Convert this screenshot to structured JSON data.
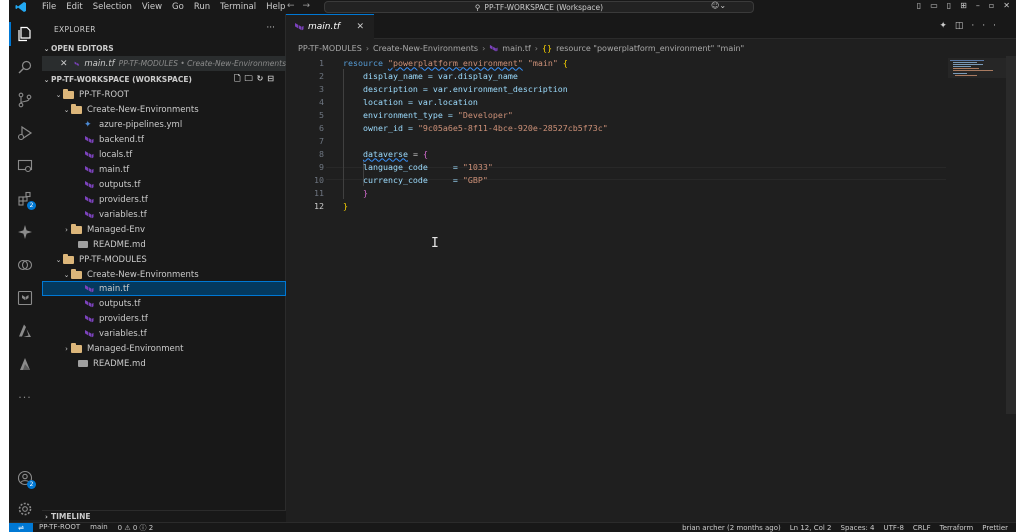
{
  "titlebar": {
    "menu": [
      "File",
      "Edit",
      "Selection",
      "View",
      "Go",
      "Run",
      "Terminal",
      "Help"
    ],
    "command_center": "PP-TF-WORKSPACE (Workspace)"
  },
  "activity": {
    "extensions_badge": "2",
    "accounts_badge": "2"
  },
  "sidebar": {
    "title": "EXPLORER",
    "open_editors": {
      "label": "OPEN EDITORS",
      "file": "main.tf",
      "path": "PP-TF-MODULES • Create-New-Environments"
    },
    "workspace_label": "PP-TF-WORKSPACE (WORKSPACE)",
    "root": {
      "name": "PP-TF-ROOT",
      "folder": "Create-New-Environments",
      "files": [
        "azure-pipelines.yml",
        "backend.tf",
        "locals.tf",
        "main.tf",
        "outputs.tf",
        "providers.tf",
        "variables.tf"
      ],
      "collapsed_folder": "Managed-Env",
      "readme": "README.md"
    },
    "modules": {
      "name": "PP-TF-MODULES",
      "folder": "Create-New-Environments",
      "files": [
        "main.tf",
        "outputs.tf",
        "providers.tf",
        "variables.tf"
      ],
      "collapsed_folder": "Managed-Environment",
      "readme": "README.md"
    },
    "timeline": "TIMELINE"
  },
  "editor": {
    "tab_name": "main.tf",
    "breadcrumb": [
      "PP-TF-MODULES",
      "Create-New-Environments",
      "main.tf",
      "resource \"powerplatform_environment\" \"main\""
    ],
    "line_numbers": [
      "1",
      "2",
      "3",
      "4",
      "5",
      "6",
      "7",
      "8",
      "9",
      "10",
      "11",
      "12"
    ],
    "code": {
      "l1_kw": "resource",
      "l1_type": "\"powerplatform_environment\"",
      "l1_name": "\"main\"",
      "l2": "display_name = var.display_name",
      "l3": "description = var.environment_description",
      "l4": "location = var.location",
      "l5_key": "environment_type = ",
      "l5_val": "\"Developer\"",
      "l6_key": "owner_id = ",
      "l6_val": "\"9c05a6e5-8f11-4bce-920e-28527cb5f73c\"",
      "l8_key": "dataverse",
      "l8_rest": " = ",
      "l9_key": "language_code     = ",
      "l9_val": "\"1033\"",
      "l10_key": "currency_code     = ",
      "l10_val": "\"GBP\""
    }
  },
  "status": {
    "branch": "PP-TF-ROOT",
    "git_branch": "main",
    "problems": "0 ⚠ 0 ⓘ 2",
    "blame": "brian archer (2 months ago)",
    "position": "Ln 12, Col 2",
    "spaces": "Spaces: 4",
    "encoding": "UTF-8",
    "eol": "CRLF",
    "language": "Terraform",
    "formatter": "Prettier"
  },
  "colors": {
    "accent": "#0078d4",
    "folder": "#dcb67a",
    "terraform": "#7b42bc",
    "keyword": "#569cd6",
    "string": "#ce9178",
    "variable": "#9cdcfe"
  }
}
